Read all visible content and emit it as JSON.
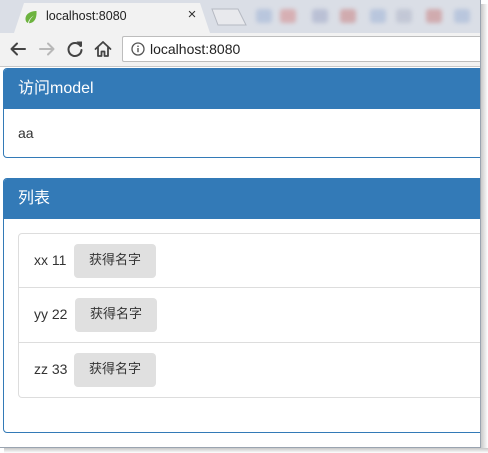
{
  "browser": {
    "tab_title": "localhost:8080",
    "tab_close_glyph": "×",
    "url": "localhost:8080",
    "icons": {
      "favicon": "spring-leaf-icon",
      "back": "arrow-left-icon",
      "forward": "arrow-right-icon",
      "reload": "reload-icon",
      "home": "home-icon",
      "site_info": "info-icon",
      "close_tab": "close-icon"
    }
  },
  "colors": {
    "panel_primary": "#337ab7",
    "tabstrip_bg": "#dadee6",
    "button_bg": "#e0e0e0",
    "favicon_green": "#6db33f"
  },
  "panel_model": {
    "heading": "访问model",
    "body": "aa"
  },
  "panel_list": {
    "heading": "列表",
    "items": [
      {
        "text": "xx 11",
        "button": "获得名字"
      },
      {
        "text": "yy 22",
        "button": "获得名字"
      },
      {
        "text": "zz 33",
        "button": "获得名字"
      }
    ]
  }
}
